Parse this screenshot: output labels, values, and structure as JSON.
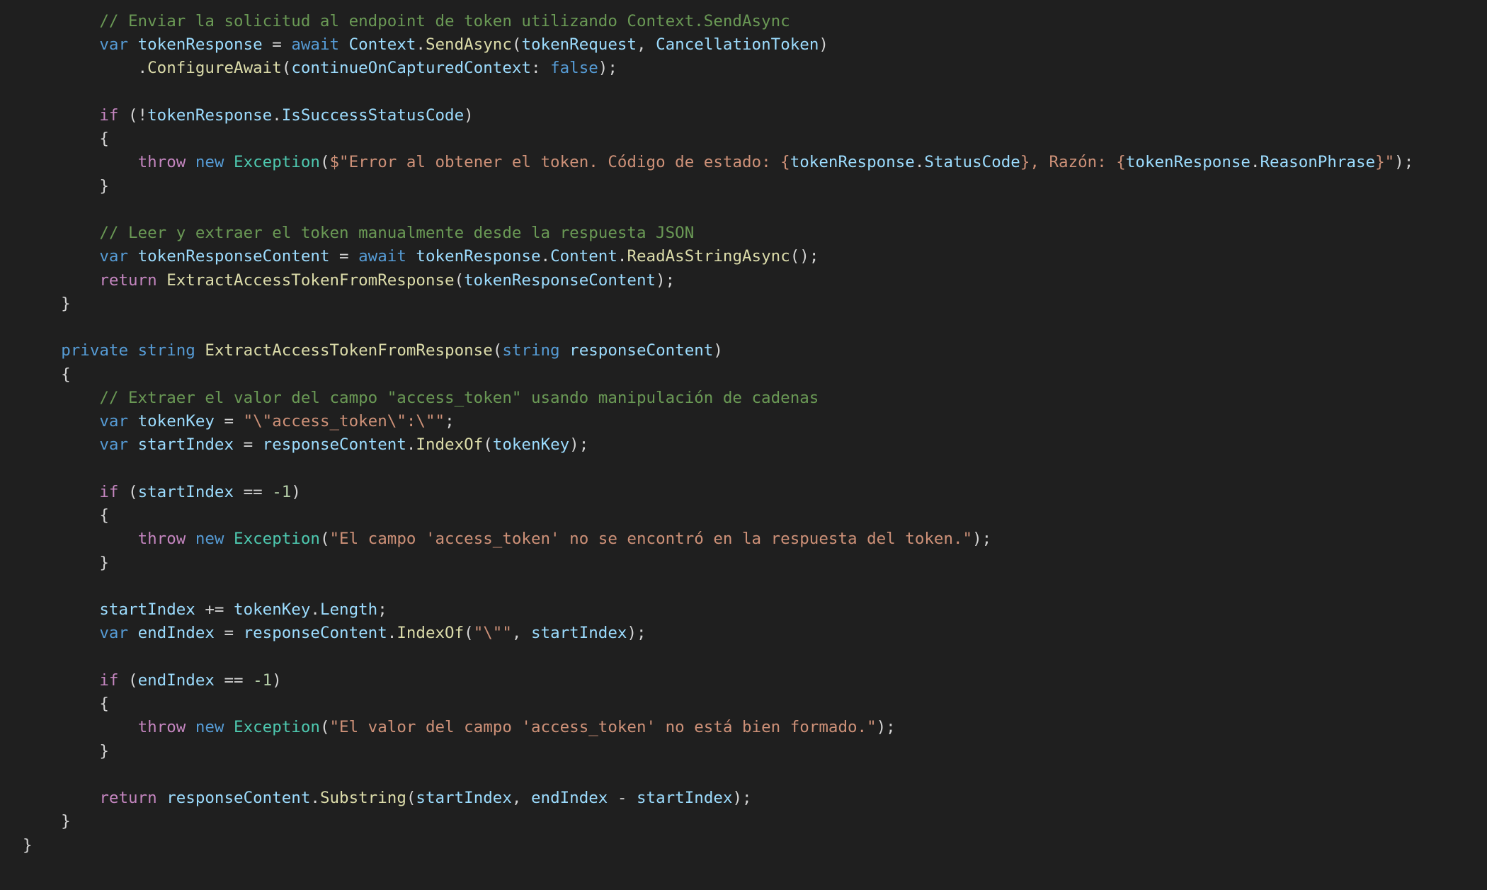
{
  "colors": {
    "background": "#1f1f1f",
    "keyword": "#569cd6",
    "control": "#c586c0",
    "variable": "#9cdcfe",
    "function": "#dcdcaa",
    "type": "#4ec9b0",
    "string": "#ce9178",
    "number": "#b5cea8",
    "comment": "#6a9955",
    "punctuation": "#d4d4d4"
  },
  "code": {
    "lines": [
      [
        [
          "        ",
          "pun"
        ],
        [
          "// Enviar la solicitud al endpoint de token utilizando Context.SendAsync",
          "com"
        ]
      ],
      [
        [
          "        ",
          "pun"
        ],
        [
          "var",
          "kw"
        ],
        [
          " ",
          "pun"
        ],
        [
          "tokenResponse",
          "var"
        ],
        [
          " = ",
          "pun"
        ],
        [
          "await",
          "kw"
        ],
        [
          " ",
          "pun"
        ],
        [
          "Context",
          "var"
        ],
        [
          ".",
          "pun"
        ],
        [
          "SendAsync",
          "fn"
        ],
        [
          "(",
          "pun"
        ],
        [
          "tokenRequest",
          "var"
        ],
        [
          ", ",
          "pun"
        ],
        [
          "CancellationToken",
          "var"
        ],
        [
          ")",
          "pun"
        ]
      ],
      [
        [
          "            .",
          "pun"
        ],
        [
          "ConfigureAwait",
          "fn"
        ],
        [
          "(",
          "pun"
        ],
        [
          "continueOnCapturedContext",
          "var"
        ],
        [
          ": ",
          "pun"
        ],
        [
          "false",
          "kw"
        ],
        [
          ");",
          "pun"
        ]
      ],
      [],
      [
        [
          "        ",
          "pun"
        ],
        [
          "if",
          "ctrl"
        ],
        [
          " (!",
          "pun"
        ],
        [
          "tokenResponse",
          "var"
        ],
        [
          ".",
          "pun"
        ],
        [
          "IsSuccessStatusCode",
          "var"
        ],
        [
          ")",
          "pun"
        ]
      ],
      [
        [
          "        {",
          "pun"
        ]
      ],
      [
        [
          "            ",
          "pun"
        ],
        [
          "throw",
          "ctrl"
        ],
        [
          " ",
          "pun"
        ],
        [
          "new",
          "kw"
        ],
        [
          " ",
          "pun"
        ],
        [
          "Exception",
          "type"
        ],
        [
          "(",
          "pun"
        ],
        [
          "$\"Error al obtener el token. Código de estado: {",
          "str"
        ],
        [
          "tokenResponse",
          "var"
        ],
        [
          ".",
          "pun"
        ],
        [
          "StatusCode",
          "var"
        ],
        [
          "}, Razón: {",
          "str"
        ],
        [
          "tokenResponse",
          "var"
        ],
        [
          ".",
          "pun"
        ],
        [
          "ReasonPhrase",
          "var"
        ],
        [
          "}\"",
          "str"
        ],
        [
          ");",
          "pun"
        ]
      ],
      [
        [
          "        }",
          "pun"
        ]
      ],
      [],
      [
        [
          "        ",
          "pun"
        ],
        [
          "// Leer y extraer el token manualmente desde la respuesta JSON",
          "com"
        ]
      ],
      [
        [
          "        ",
          "pun"
        ],
        [
          "var",
          "kw"
        ],
        [
          " ",
          "pun"
        ],
        [
          "tokenResponseContent",
          "var"
        ],
        [
          " = ",
          "pun"
        ],
        [
          "await",
          "kw"
        ],
        [
          " ",
          "pun"
        ],
        [
          "tokenResponse",
          "var"
        ],
        [
          ".",
          "pun"
        ],
        [
          "Content",
          "var"
        ],
        [
          ".",
          "pun"
        ],
        [
          "ReadAsStringAsync",
          "fn"
        ],
        [
          "();",
          "pun"
        ]
      ],
      [
        [
          "        ",
          "pun"
        ],
        [
          "return",
          "ctrl"
        ],
        [
          " ",
          "pun"
        ],
        [
          "ExtractAccessTokenFromResponse",
          "fn"
        ],
        [
          "(",
          "pun"
        ],
        [
          "tokenResponseContent",
          "var"
        ],
        [
          ");",
          "pun"
        ]
      ],
      [
        [
          "    }",
          "pun"
        ]
      ],
      [],
      [
        [
          "    ",
          "pun"
        ],
        [
          "private",
          "kw"
        ],
        [
          " ",
          "pun"
        ],
        [
          "string",
          "kw"
        ],
        [
          " ",
          "pun"
        ],
        [
          "ExtractAccessTokenFromResponse",
          "fn"
        ],
        [
          "(",
          "pun"
        ],
        [
          "string",
          "kw"
        ],
        [
          " ",
          "pun"
        ],
        [
          "responseContent",
          "var"
        ],
        [
          ")",
          "pun"
        ]
      ],
      [
        [
          "    {",
          "pun"
        ]
      ],
      [
        [
          "        ",
          "pun"
        ],
        [
          "// Extraer el valor del campo \"access_token\" usando manipulación de cadenas",
          "com"
        ]
      ],
      [
        [
          "        ",
          "pun"
        ],
        [
          "var",
          "kw"
        ],
        [
          " ",
          "pun"
        ],
        [
          "tokenKey",
          "var"
        ],
        [
          " = ",
          "pun"
        ],
        [
          "\"\\\"access_token\\\":\\\"\"",
          "str"
        ],
        [
          ";",
          "pun"
        ]
      ],
      [
        [
          "        ",
          "pun"
        ],
        [
          "var",
          "kw"
        ],
        [
          " ",
          "pun"
        ],
        [
          "startIndex",
          "var"
        ],
        [
          " = ",
          "pun"
        ],
        [
          "responseContent",
          "var"
        ],
        [
          ".",
          "pun"
        ],
        [
          "IndexOf",
          "fn"
        ],
        [
          "(",
          "pun"
        ],
        [
          "tokenKey",
          "var"
        ],
        [
          ");",
          "pun"
        ]
      ],
      [],
      [
        [
          "        ",
          "pun"
        ],
        [
          "if",
          "ctrl"
        ],
        [
          " (",
          "pun"
        ],
        [
          "startIndex",
          "var"
        ],
        [
          " == ",
          "pun"
        ],
        [
          "-1",
          "num"
        ],
        [
          ")",
          "pun"
        ]
      ],
      [
        [
          "        {",
          "pun"
        ]
      ],
      [
        [
          "            ",
          "pun"
        ],
        [
          "throw",
          "ctrl"
        ],
        [
          " ",
          "pun"
        ],
        [
          "new",
          "kw"
        ],
        [
          " ",
          "pun"
        ],
        [
          "Exception",
          "type"
        ],
        [
          "(",
          "pun"
        ],
        [
          "\"El campo 'access_token' no se encontró en la respuesta del token.\"",
          "str"
        ],
        [
          ");",
          "pun"
        ]
      ],
      [
        [
          "        }",
          "pun"
        ]
      ],
      [],
      [
        [
          "        ",
          "pun"
        ],
        [
          "startIndex",
          "var"
        ],
        [
          " += ",
          "pun"
        ],
        [
          "tokenKey",
          "var"
        ],
        [
          ".",
          "pun"
        ],
        [
          "Length",
          "var"
        ],
        [
          ";",
          "pun"
        ]
      ],
      [
        [
          "        ",
          "pun"
        ],
        [
          "var",
          "kw"
        ],
        [
          " ",
          "pun"
        ],
        [
          "endIndex",
          "var"
        ],
        [
          " = ",
          "pun"
        ],
        [
          "responseContent",
          "var"
        ],
        [
          ".",
          "pun"
        ],
        [
          "IndexOf",
          "fn"
        ],
        [
          "(",
          "pun"
        ],
        [
          "\"\\\"\"",
          "str"
        ],
        [
          ", ",
          "pun"
        ],
        [
          "startIndex",
          "var"
        ],
        [
          ");",
          "pun"
        ]
      ],
      [],
      [
        [
          "        ",
          "pun"
        ],
        [
          "if",
          "ctrl"
        ],
        [
          " (",
          "pun"
        ],
        [
          "endIndex",
          "var"
        ],
        [
          " == ",
          "pun"
        ],
        [
          "-1",
          "num"
        ],
        [
          ")",
          "pun"
        ]
      ],
      [
        [
          "        {",
          "pun"
        ]
      ],
      [
        [
          "            ",
          "pun"
        ],
        [
          "throw",
          "ctrl"
        ],
        [
          " ",
          "pun"
        ],
        [
          "new",
          "kw"
        ],
        [
          " ",
          "pun"
        ],
        [
          "Exception",
          "type"
        ],
        [
          "(",
          "pun"
        ],
        [
          "\"El valor del campo 'access_token' no está bien formado.\"",
          "str"
        ],
        [
          ");",
          "pun"
        ]
      ],
      [
        [
          "        }",
          "pun"
        ]
      ],
      [],
      [
        [
          "        ",
          "pun"
        ],
        [
          "return",
          "ctrl"
        ],
        [
          " ",
          "pun"
        ],
        [
          "responseContent",
          "var"
        ],
        [
          ".",
          "pun"
        ],
        [
          "Substring",
          "fn"
        ],
        [
          "(",
          "pun"
        ],
        [
          "startIndex",
          "var"
        ],
        [
          ", ",
          "pun"
        ],
        [
          "endIndex",
          "var"
        ],
        [
          " - ",
          "pun"
        ],
        [
          "startIndex",
          "var"
        ],
        [
          ");",
          "pun"
        ]
      ],
      [
        [
          "    }",
          "pun"
        ]
      ],
      [
        [
          "}",
          "pun"
        ]
      ]
    ]
  }
}
